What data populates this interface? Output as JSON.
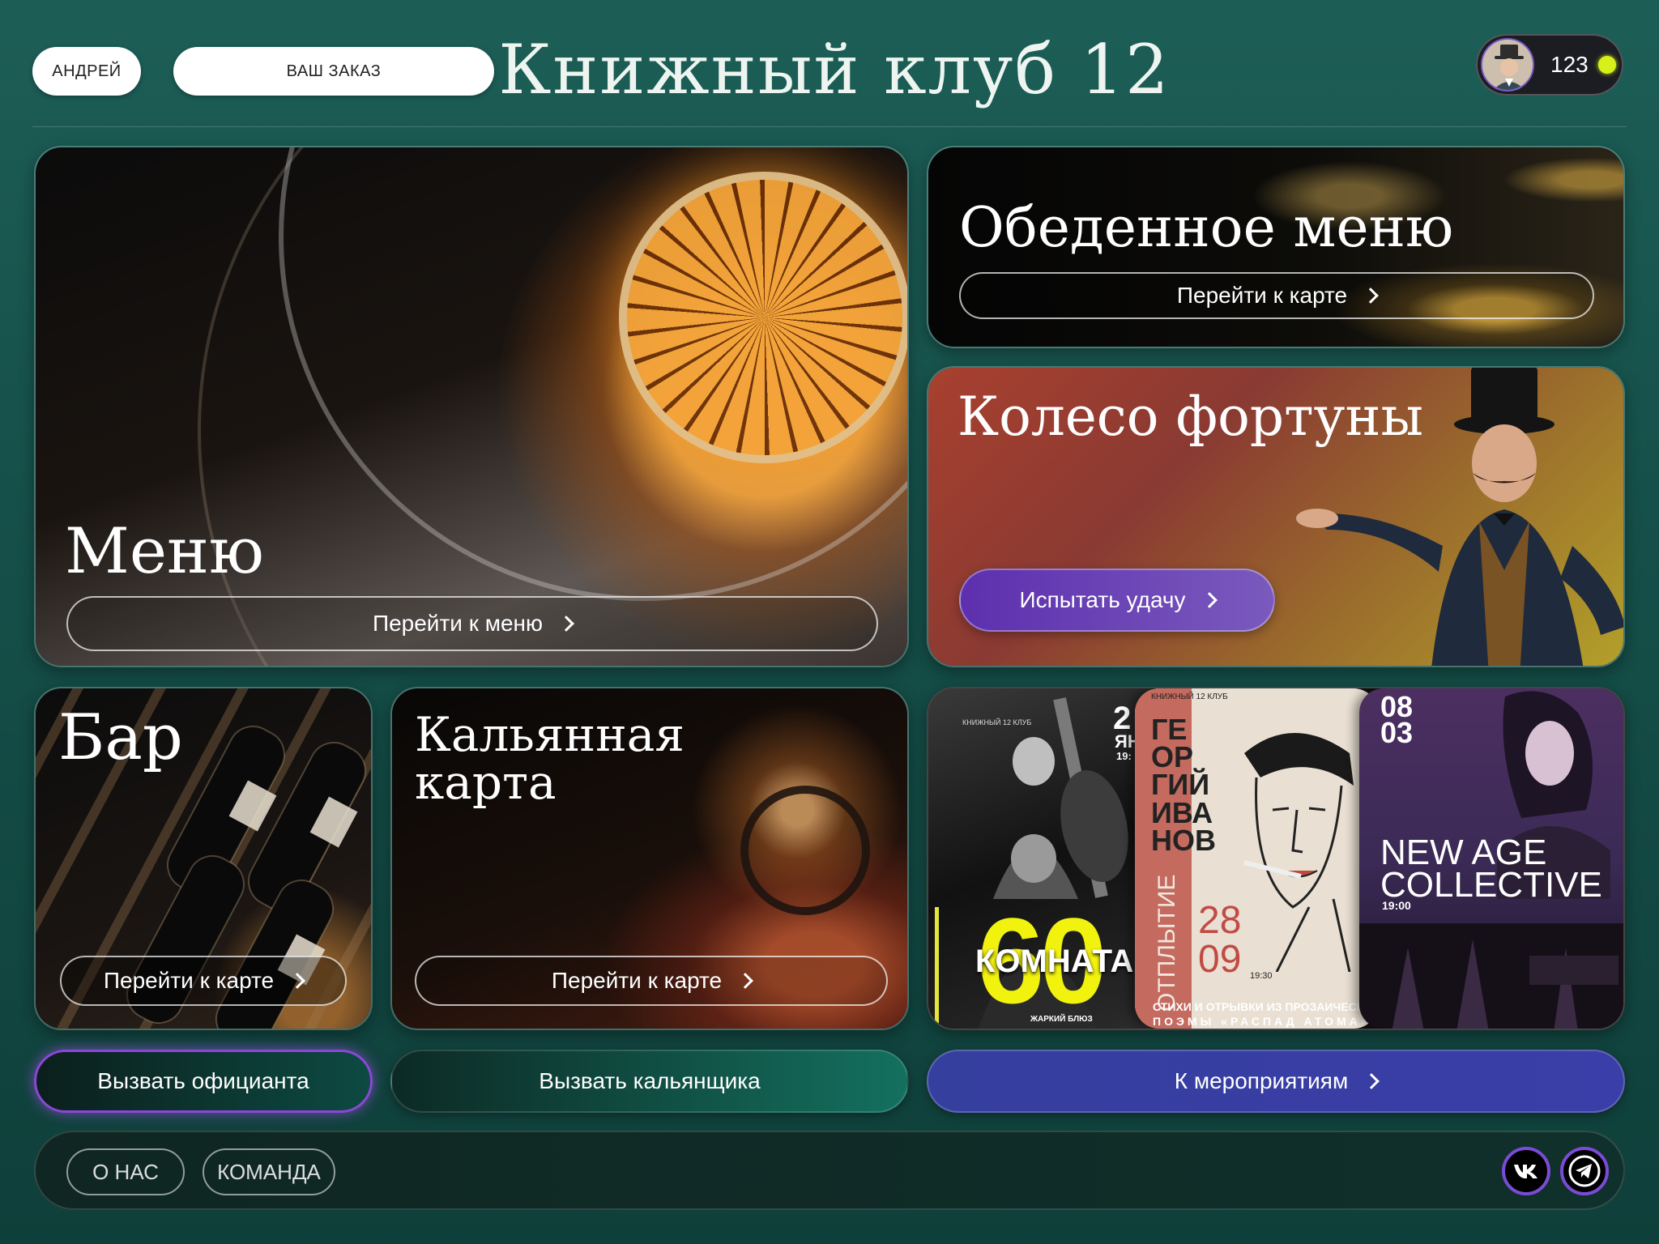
{
  "header": {
    "user_name": "АНДРЕЙ",
    "order_label": "ВАШ ЗАКАЗ",
    "brand": "Книжный клуб 12",
    "points": "123",
    "status_color": "#d7f019"
  },
  "cards": {
    "menu": {
      "title": "Меню",
      "button": "Перейти к меню"
    },
    "lunch": {
      "title": "Обеденное меню",
      "button": "Перейти к карте"
    },
    "fortune": {
      "title": "Колесо фортуны",
      "button": "Испытать удачу"
    },
    "bar": {
      "title": "Бар",
      "button": "Перейти к карте"
    },
    "hookah": {
      "title_line1": "Кальянная",
      "title_line2": "карта",
      "button": "Перейти к карте"
    }
  },
  "events": {
    "poster1": {
      "brand": "КНИЖНЫЙ 12 КЛУБ",
      "date": "2",
      "month": "ЯН",
      "time": "19:",
      "big": "60",
      "headline": "КОМНАТА",
      "sub": "ЖАРКИЙ БЛЮЗ"
    },
    "poster2": {
      "brand": "КНИЖНЫЙ 12 КЛУБ",
      "name_lines": [
        "ГЕ",
        "ОР",
        "ГИЙ",
        "ИВА",
        "НОВ"
      ],
      "vertical": "ОТПЛЫТИЕ",
      "day": "28",
      "month": "09",
      "time": "19:30",
      "caption1": "СТИХИ И ОТРЫВКИ ИЗ ПРОЗАИЧЕСК",
      "caption2": "ПОЭМЫ «РАСПАД АТОМА»"
    },
    "poster3": {
      "day": "08",
      "month": "03",
      "title_line1": "NEW AGE",
      "title_line2": "COLLECTIVE",
      "time": "19:00"
    }
  },
  "actions": {
    "call_waiter": "Вызвать официанта",
    "call_hookah": "Вызвать кальянщика",
    "to_events": "К мероприятиям"
  },
  "footer": {
    "about": "О НАС",
    "team": "КОМАНДА",
    "vk_icon": "vk-icon",
    "telegram_icon": "telegram-icon"
  },
  "colors": {
    "accent_purple": "#7b4bd6",
    "events_blue": "#3a3ea8",
    "status_green": "#d7f019"
  }
}
